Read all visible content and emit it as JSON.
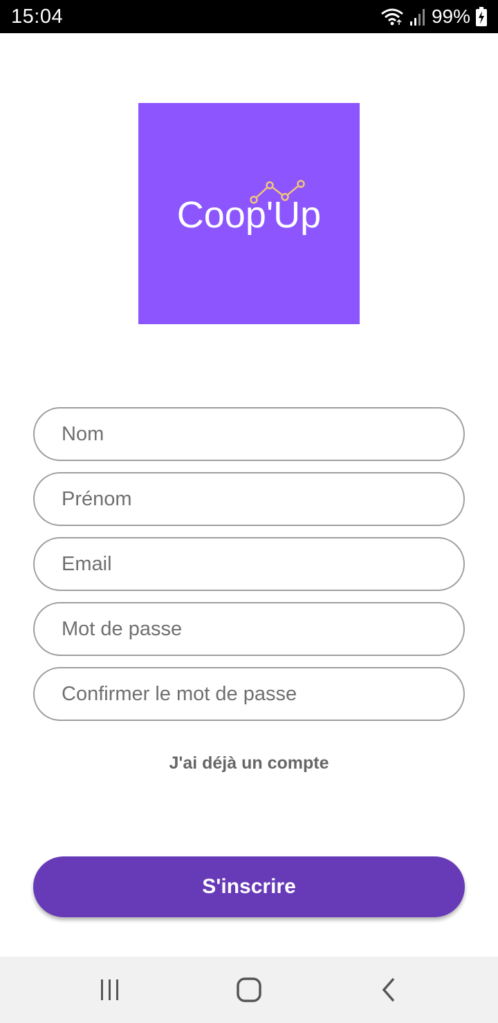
{
  "status_bar": {
    "time": "15:04",
    "battery": "99%",
    "icons": [
      "wifi-icon",
      "signal-icon",
      "battery-charging-icon"
    ]
  },
  "logo": {
    "text": "Coop'Up",
    "background_color": "#8c55fe",
    "accent_color": "#f0c37a"
  },
  "form": {
    "last_name_placeholder": "Nom",
    "first_name_placeholder": "Prénom",
    "email_placeholder": "Email",
    "password_placeholder": "Mot de passe",
    "confirm_password_placeholder": "Confirmer le mot de passe"
  },
  "login_link": "J'ai déjà un compte",
  "signup_button": "S'inscrire",
  "colors": {
    "primary": "#673ab7"
  },
  "nav_bar": {
    "icons": [
      "recent-apps-icon",
      "home-icon",
      "back-icon"
    ]
  }
}
